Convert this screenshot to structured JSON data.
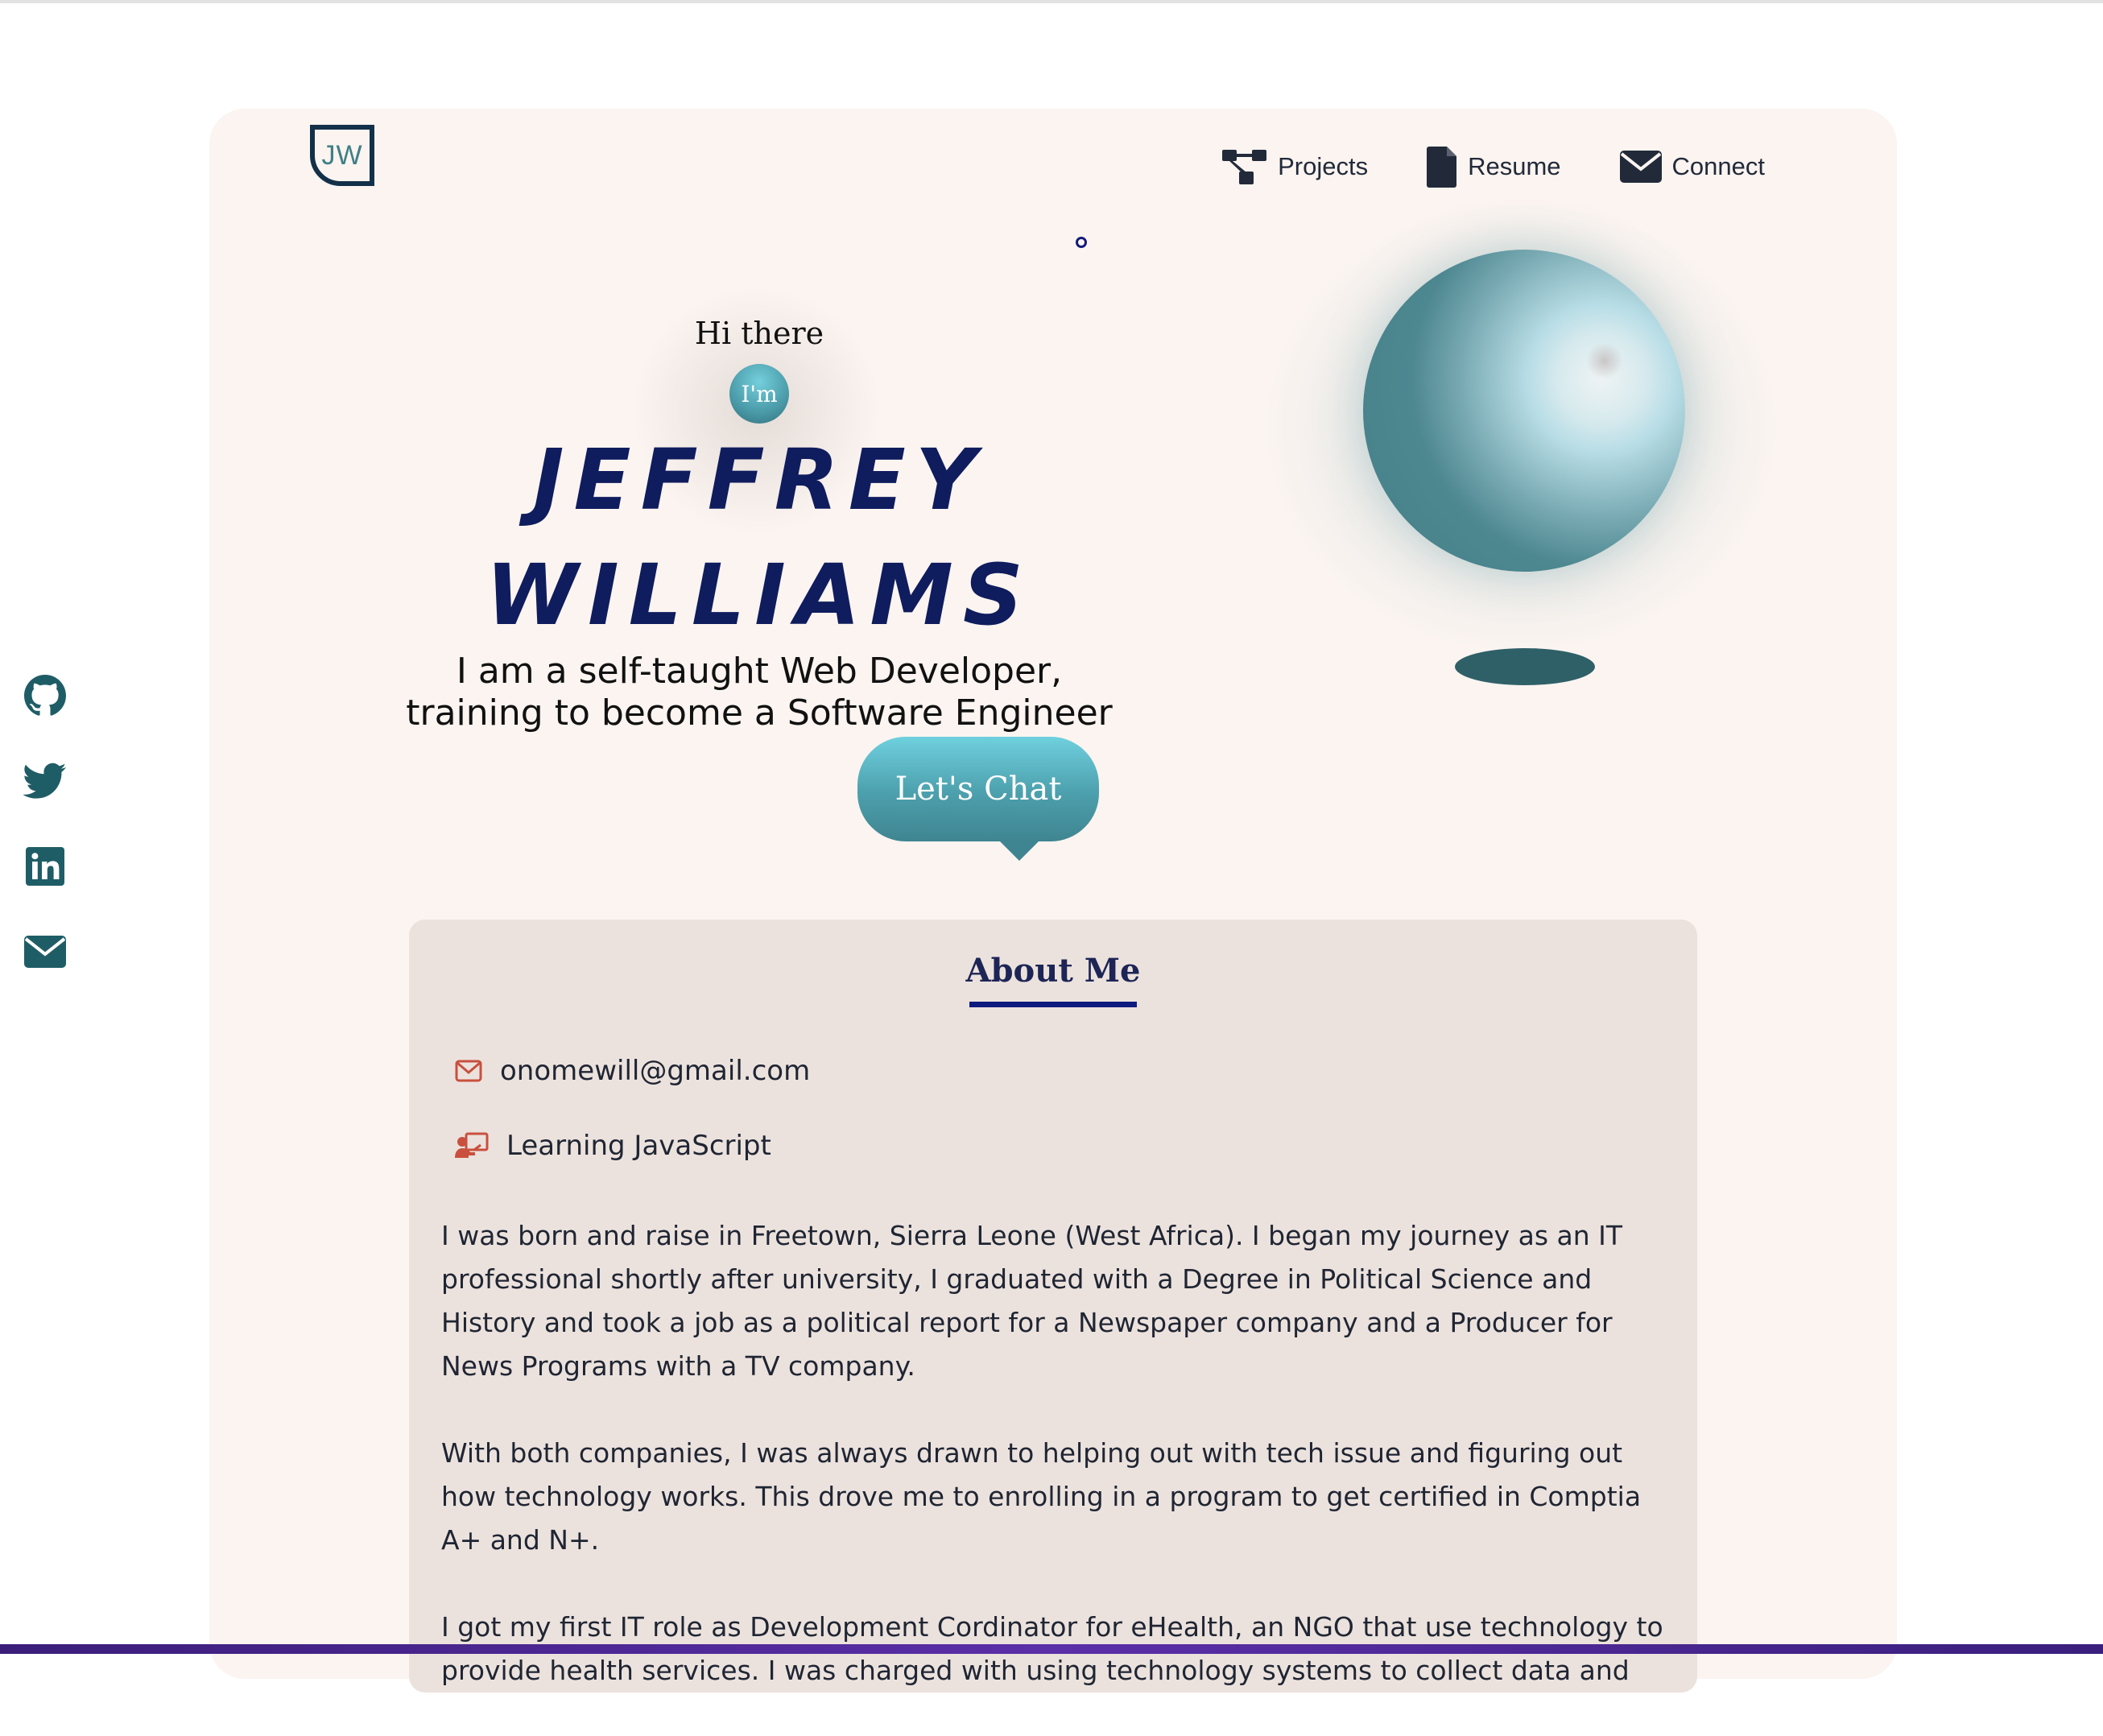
{
  "logo": {
    "text": "JW"
  },
  "nav": [
    {
      "label": "Projects",
      "icon": "sitemap-icon"
    },
    {
      "label": "Resume",
      "icon": "file-icon"
    },
    {
      "label": "Connect",
      "icon": "envelope-icon"
    }
  ],
  "hero": {
    "greeting": "Hi there",
    "im_badge": "I'm",
    "first_name": "JEFFREY",
    "last_name": "WILLIAMS",
    "tagline_line1": "I am a self-taught Web Developer,",
    "tagline_line2": "training to become a Software Engineer",
    "chat_button": "Let's Chat"
  },
  "social": [
    {
      "name": "github-icon"
    },
    {
      "name": "twitter-icon"
    },
    {
      "name": "linkedin-icon"
    },
    {
      "name": "envelope-icon"
    }
  ],
  "about": {
    "title": "About Me",
    "email": "onomewill@gmail.com",
    "learning": "Learning JavaScript",
    "paragraphs": [
      "I was born and raise in Freetown, Sierra Leone (West Africa). I began my journey as an IT professional shortly after university, I graduated with a Degree in Political Science and History and took a job as a political report for a Newspaper company and a Producer for News Programs with a TV company.",
      "With both companies, I was always drawn to helping out with tech issue and figuring out how technology works. This drove me to enrolling in a program to get certified in Comptia A+ and N+.",
      "I got my first IT role as Development Cordinator for eHealth, an NGO that use technology to provide health services. I was charged with using technology systems to collect data and"
    ]
  },
  "colors": {
    "card_bg": "#fbf4f0",
    "about_bg": "#ece2dd",
    "name_color": "#0f1c5e",
    "accent_teal": "#4c9fac",
    "icon_orange": "#c9503e",
    "social_icon": "#1f5d66"
  }
}
